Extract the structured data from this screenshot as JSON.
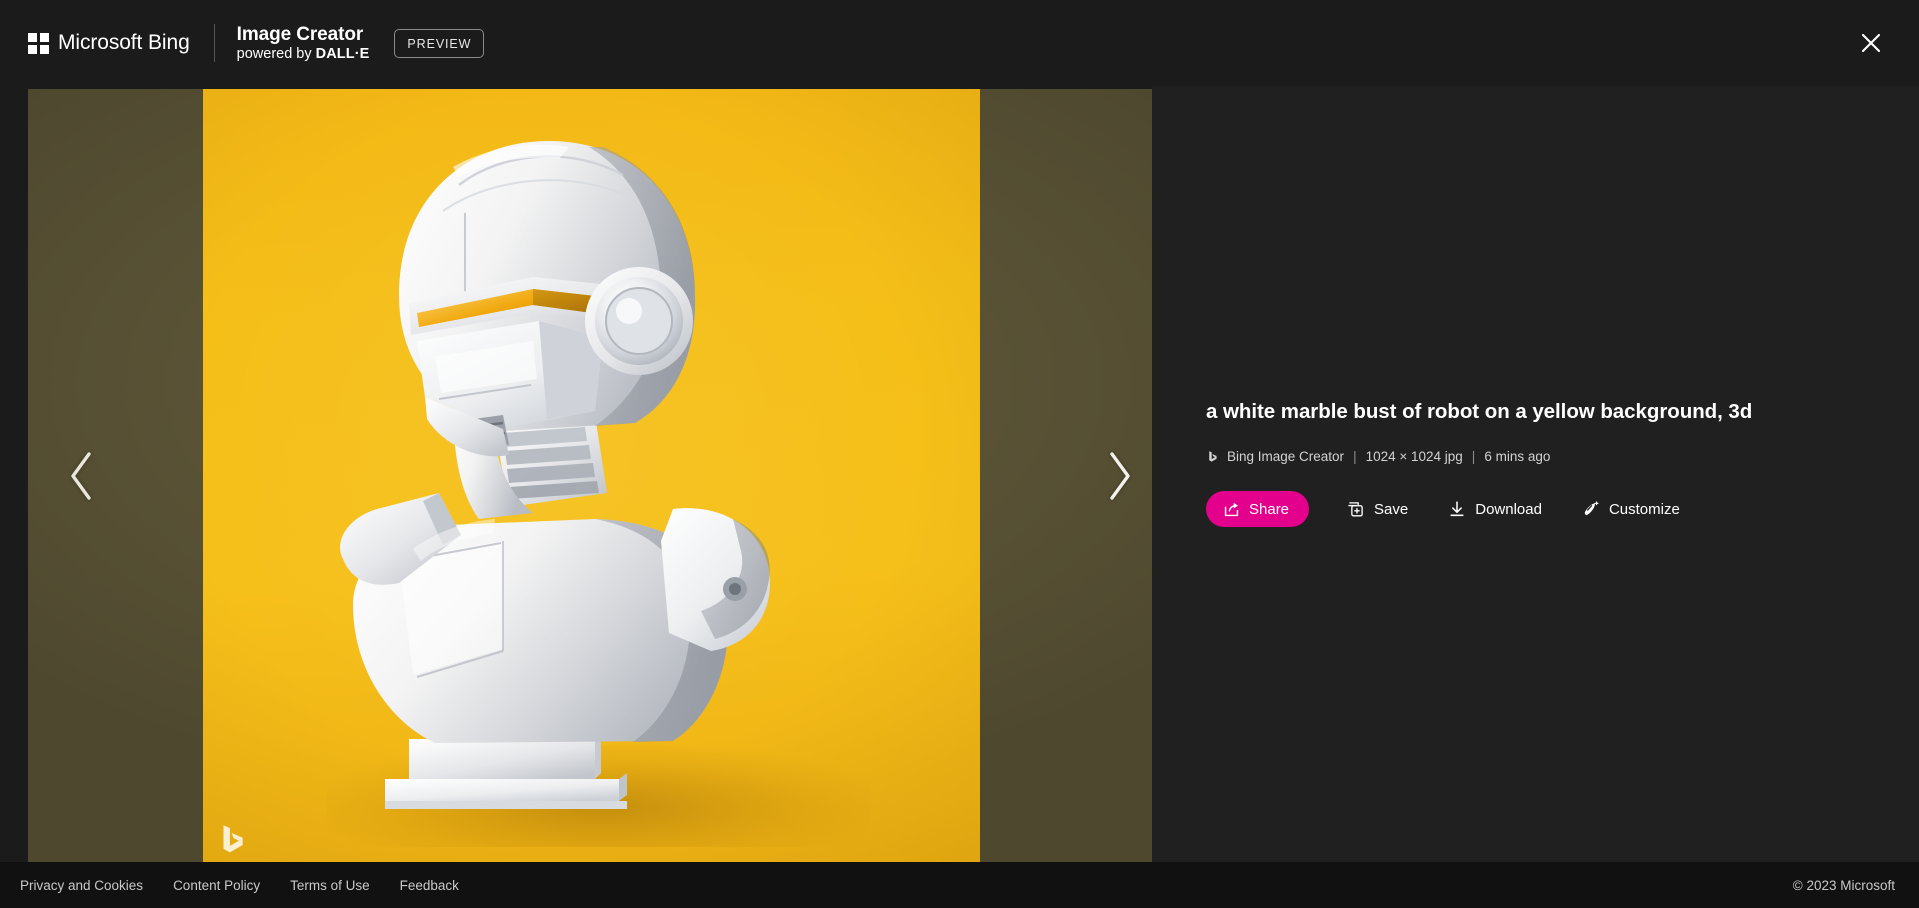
{
  "header": {
    "brand": "Microsoft Bing",
    "product_title": "Image Creator",
    "product_sub_prefix": "powered by ",
    "product_sub_strong": "DALL·E",
    "preview_badge": "PREVIEW",
    "close_label": "Close"
  },
  "viewer": {
    "prev_label": "Previous image",
    "next_label": "Next image",
    "watermark": "bing-b-logo",
    "image_alt": "a white marble bust of robot on a yellow background, 3d",
    "image_background_color": "#f5be18",
    "backdrop_color": "#544d32"
  },
  "detail": {
    "prompt": "a white marble bust of robot on a yellow background, 3d",
    "source": "Bing Image Creator",
    "dimensions": "1024 × 1024 jpg",
    "time": "6 mins ago",
    "separator": "|",
    "actions": [
      {
        "id": "share",
        "label": "Share",
        "icon": "share-icon",
        "accent": "#e3008c",
        "primary": true
      },
      {
        "id": "save",
        "label": "Save",
        "icon": "collections-add-icon",
        "primary": false
      },
      {
        "id": "download",
        "label": "Download",
        "icon": "download-icon",
        "primary": false
      },
      {
        "id": "customize",
        "label": "Customize",
        "icon": "magic-wand-icon",
        "primary": false
      }
    ]
  },
  "footer": {
    "links": [
      "Privacy and Cookies",
      "Content Policy",
      "Terms of Use",
      "Feedback"
    ],
    "copyright": "© 2023 Microsoft"
  },
  "colors": {
    "accent_pink": "#e3008c",
    "header_bg": "#1b1b1b",
    "panel_bg": "#202020",
    "footer_bg": "#111111"
  }
}
